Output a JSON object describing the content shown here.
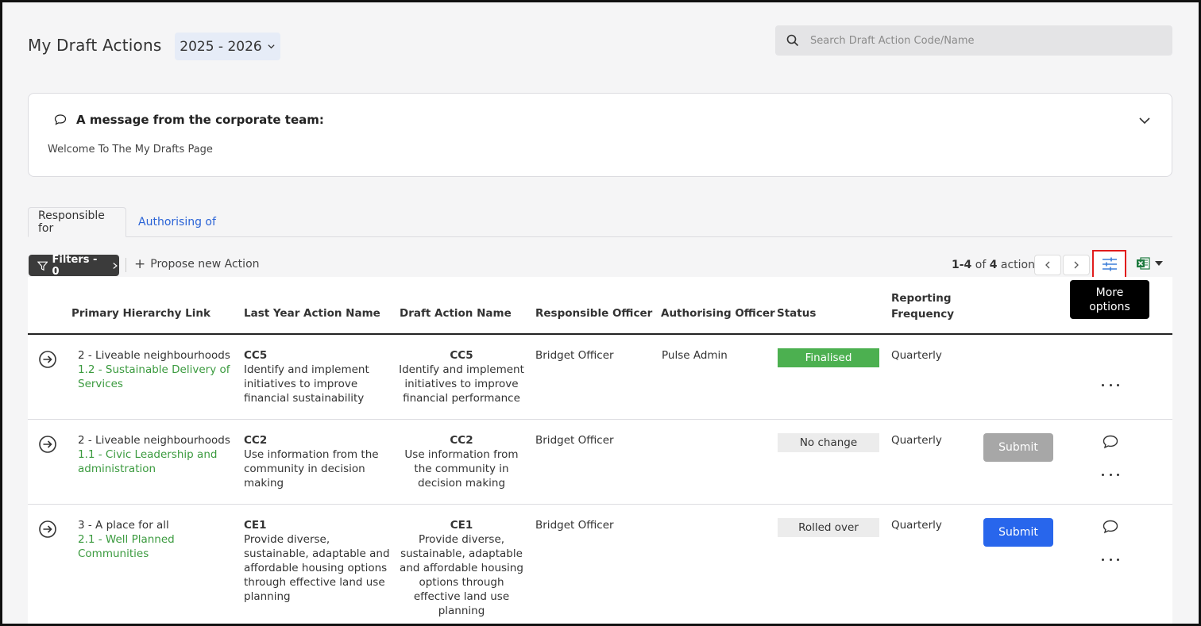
{
  "header": {
    "title": "My Draft Actions",
    "year_selector": "2025 - 2026",
    "search_placeholder": "Search Draft Action Code/Name"
  },
  "message": {
    "heading": "A message from the corporate team:",
    "body": "Welcome To The My Drafts Page"
  },
  "tabs": [
    {
      "label": "Responsible for",
      "active": true
    },
    {
      "label": "Authorising of",
      "active": false
    }
  ],
  "toolbar": {
    "filters_label": "Filters - 0",
    "propose_label": "Propose new Action",
    "pager_range": "1-4",
    "pager_of": "of",
    "pager_total": "4",
    "pager_suffix": "actions",
    "tooltip": "More options"
  },
  "table": {
    "headers": {
      "primary_hierarchy": "Primary Hierarchy Link",
      "last_year": "Last Year Action Name",
      "draft": "Draft Action Name",
      "responsible": "Responsible Officer",
      "authorising": "Authorising Officer",
      "status": "Status",
      "frequency": "Reporting Frequency"
    },
    "rows": [
      {
        "hier_top": "2 - Liveable neighbourhoods",
        "hier_link": "1.2 - Sustainable Delivery of Services",
        "last_code": "CC5",
        "last_name": "Identify and implement initiatives to improve financial sustainability",
        "draft_code": "CC5",
        "draft_name": "Identify and implement initiatives to improve financial performance",
        "responsible": "Bridget Officer",
        "authorising": "Pulse Admin",
        "status": "Finalised",
        "frequency": "Quarterly",
        "submit": ""
      },
      {
        "hier_top": "2 - Liveable neighbourhoods",
        "hier_link": "1.1 - Civic Leadership and administration",
        "last_code": "CC2",
        "last_name": "Use information from the community in decision making",
        "draft_code": "CC2",
        "draft_name": "Use information from the community in decision making",
        "responsible": "Bridget Officer",
        "authorising": "",
        "status": "No change",
        "frequency": "Quarterly",
        "submit": "Submit"
      },
      {
        "hier_top": "3 - A place for all",
        "hier_link": "2.1 - Well Planned Communities",
        "last_code": "CE1",
        "last_name": "Provide diverse, sustainable, adaptable and affordable housing options through effective land use planning",
        "draft_code": "CE1",
        "draft_name": "Provide diverse, sustainable, adaptable and affordable housing options through effective land use planning",
        "responsible": "Bridget Officer",
        "authorising": "",
        "status": "Rolled over",
        "frequency": "Quarterly",
        "submit": "Submit"
      }
    ]
  },
  "colors": {
    "finalised": "#4cb050",
    "link_green": "#3a9a3e",
    "submit_blue": "#2866ec",
    "submit_disabled": "#a7a7a7",
    "tab_blue": "#2a63d6",
    "highlight_red": "#e11c1c"
  },
  "icons": {
    "search": "search-icon",
    "comment": "comment-icon",
    "chevron": "chevron-down-icon",
    "filter": "filter-icon",
    "more_options": "sliders-icon",
    "excel": "excel-icon",
    "row_open": "arrow-circle-right-icon",
    "row_menu": "ellipsis-icon"
  }
}
